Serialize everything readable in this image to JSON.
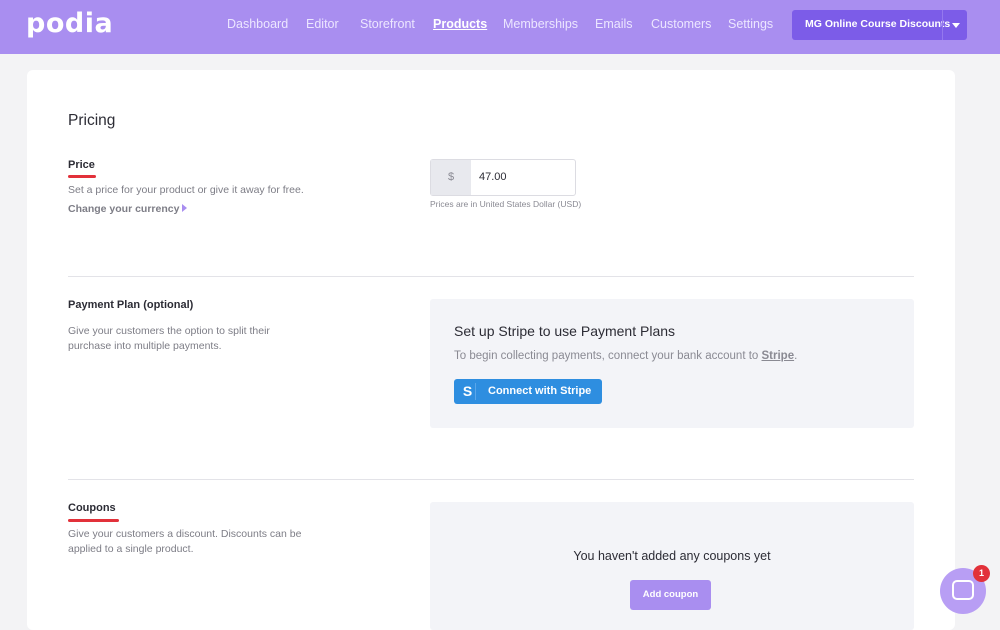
{
  "app": {
    "logo": "podia"
  },
  "nav": {
    "items": [
      {
        "label": "Dashboard"
      },
      {
        "label": "Editor"
      },
      {
        "label": "Storefront"
      },
      {
        "label": "Products",
        "active": true
      },
      {
        "label": "Memberships"
      },
      {
        "label": "Emails"
      },
      {
        "label": "Customers"
      },
      {
        "label": "Settings"
      }
    ],
    "store_selector": "MG Online Course Discounts"
  },
  "pricing": {
    "heading": "Pricing",
    "price": {
      "label": "Price",
      "description": "Set a price for your product or give it away for free.",
      "change_currency": "Change your currency",
      "currency_symbol": "$",
      "value": "47.00",
      "note": "Prices are in United States Dollar (USD)"
    },
    "payment_plan": {
      "label": "Payment Plan (optional)",
      "description": "Give your customers the option to split their purchase into multiple payments.",
      "panel_title": "Set up Stripe to use Payment Plans",
      "panel_sub_prefix": "To begin collecting payments, connect your bank account to ",
      "panel_sub_link": "Stripe",
      "panel_sub_suffix": ".",
      "button_icon": "S",
      "button_label": "Connect with Stripe"
    },
    "coupons": {
      "label": "Coupons",
      "description": "Give your customers a discount. Discounts can be applied to a single product.",
      "empty_text": "You haven't added any coupons yet",
      "add_button": "Add coupon"
    }
  },
  "chat": {
    "badge_count": "1",
    "icon": "chat-bubble-icon"
  },
  "colors": {
    "brand": "#a98ef0",
    "brand_dark": "#7c5ce8",
    "stripe_blue": "#2e8ee0",
    "accent_red": "#e2313a"
  }
}
